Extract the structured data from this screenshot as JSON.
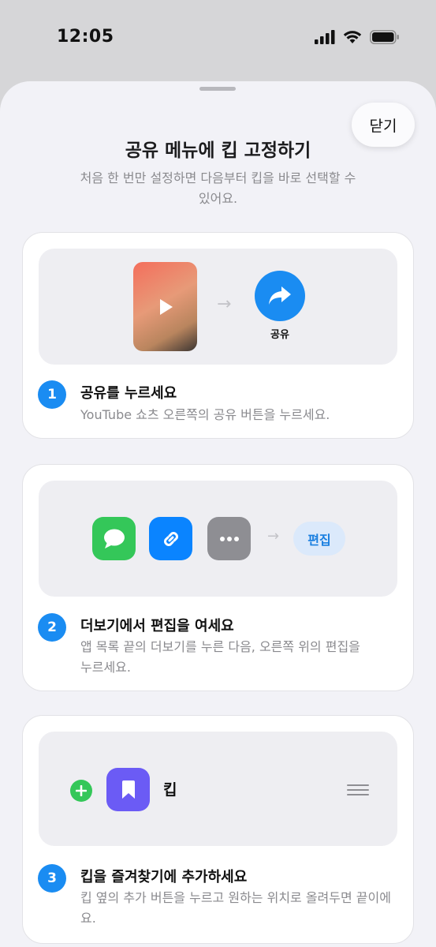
{
  "status_bar": {
    "time": "12:05"
  },
  "sheet": {
    "close_label": "닫기",
    "title": "공유 메뉴에 킵 고정하기",
    "subtitle": "처음 한 번만 설정하면 다음부터 킵을 바로 선택할 수 있어요."
  },
  "steps": [
    {
      "number": "1",
      "title": "공유를 누르세요",
      "description": "YouTube 쇼츠 오른쪽의 공유 버튼을 누르세요.",
      "share_label": "공유"
    },
    {
      "number": "2",
      "title": "더보기에서 편집을 여세요",
      "description": "앱 목록 끝의 더보기를 누른 다음, 오른쪽 위의 편집을 누르세요.",
      "edit_label": "편집"
    },
    {
      "number": "3",
      "title": "킵을 즐겨찾기에 추가하세요",
      "description": "킵 옆의 추가 버튼을 누르고 원하는 위치로 올려두면 끝이에요.",
      "app_name": "킵"
    }
  ],
  "colors": {
    "accent": "#1a8cf2",
    "messages_green": "#34c759",
    "link_blue": "#0a84ff",
    "more_gray": "#8e8e93",
    "keep_purple": "#6b5bf5",
    "add_green": "#34c759",
    "edit_chip_bg": "#dbe9fb"
  }
}
